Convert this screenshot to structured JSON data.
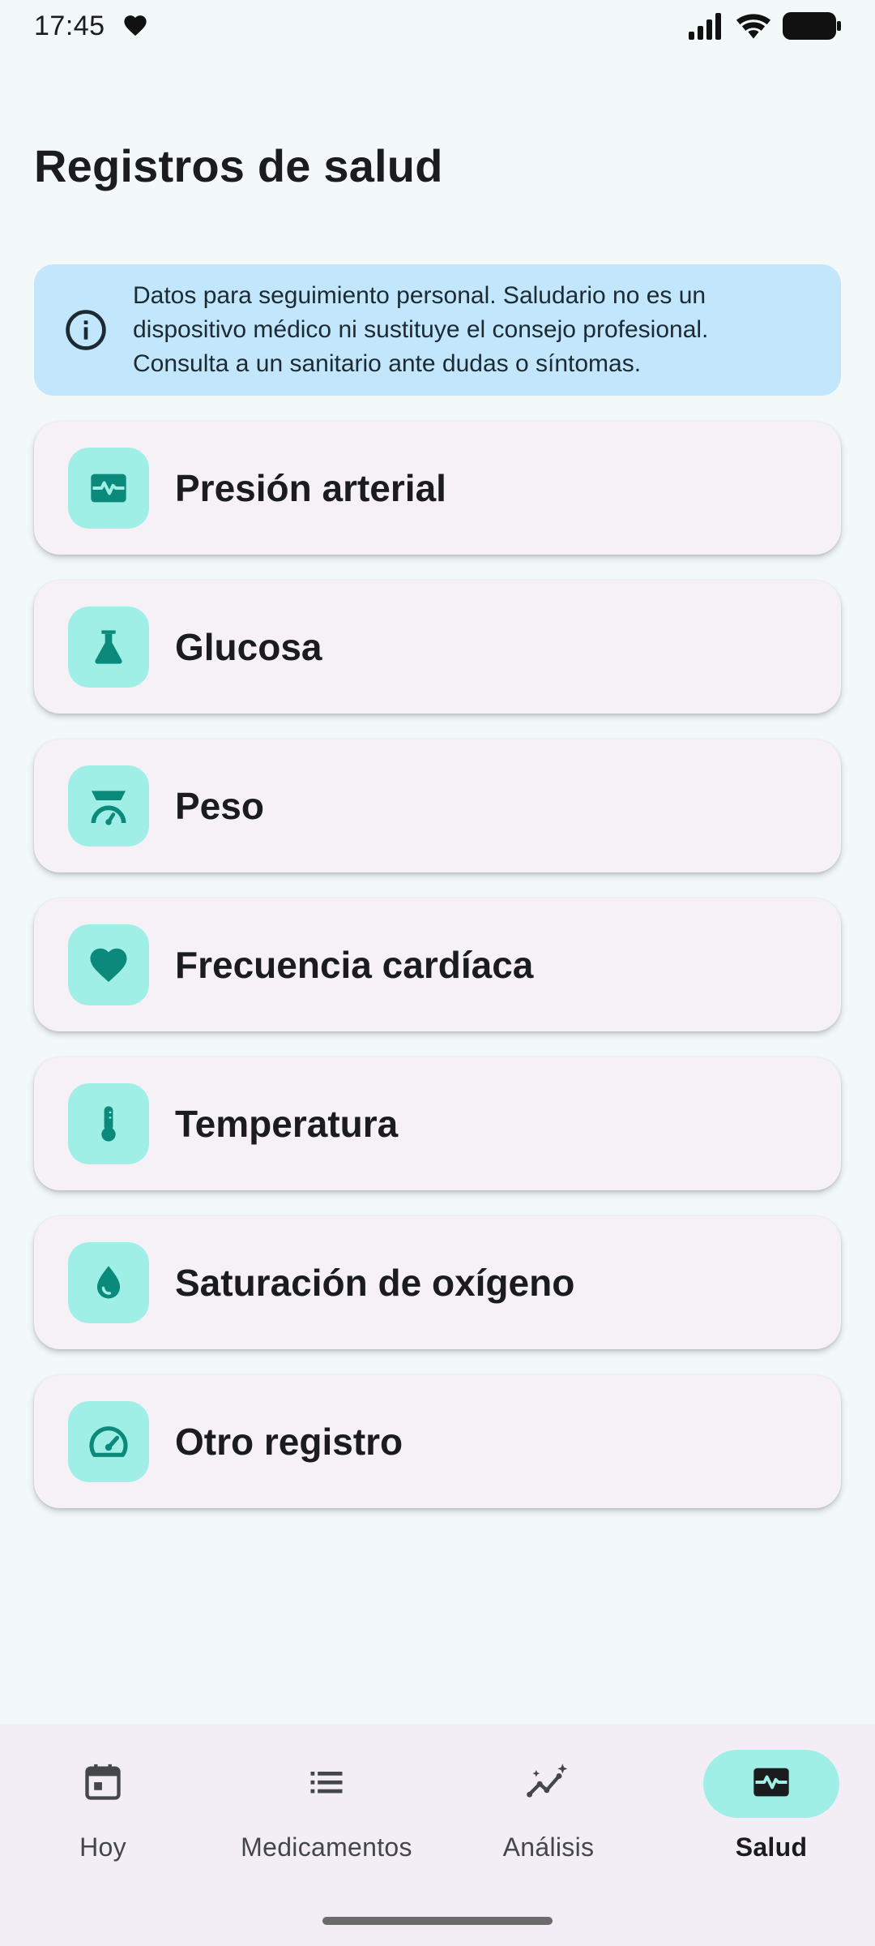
{
  "status_bar": {
    "time": "17:45",
    "icons": [
      "heart-icon",
      "signal-icon",
      "wifi-icon",
      "battery-icon"
    ]
  },
  "page": {
    "title": "Registros de salud"
  },
  "disclaimer": {
    "icon": "info-icon",
    "text": "Datos para seguimiento personal. Saludario no es un dispositivo médico ni sustituye el consejo profesional. Consulta a un sanitario ante dudas o síntomas."
  },
  "records": [
    {
      "label": "Presión arterial",
      "icon": "blood-pressure-icon"
    },
    {
      "label": "Glucosa",
      "icon": "flask-icon"
    },
    {
      "label": "Peso",
      "icon": "scale-icon"
    },
    {
      "label": "Frecuencia cardíaca",
      "icon": "heart-icon"
    },
    {
      "label": "Temperatura",
      "icon": "thermometer-icon"
    },
    {
      "label": "Saturación de oxígeno",
      "icon": "drop-icon"
    },
    {
      "label": "Otro registro",
      "icon": "gauge-icon"
    }
  ],
  "bottom_nav": {
    "items": [
      {
        "label": "Hoy",
        "icon": "calendar-icon",
        "active": false
      },
      {
        "label": "Medicamentos",
        "icon": "list-icon",
        "active": false
      },
      {
        "label": "Análisis",
        "icon": "analytics-icon",
        "active": false
      },
      {
        "label": "Salud",
        "icon": "monitor-heart-icon",
        "active": true
      }
    ]
  },
  "colors": {
    "background": "#f3f8f8",
    "accent": "#0b8a7c",
    "accent_container": "#a0efe6",
    "info_background": "#c2e6fb",
    "card_background": "#f6f0f7"
  }
}
